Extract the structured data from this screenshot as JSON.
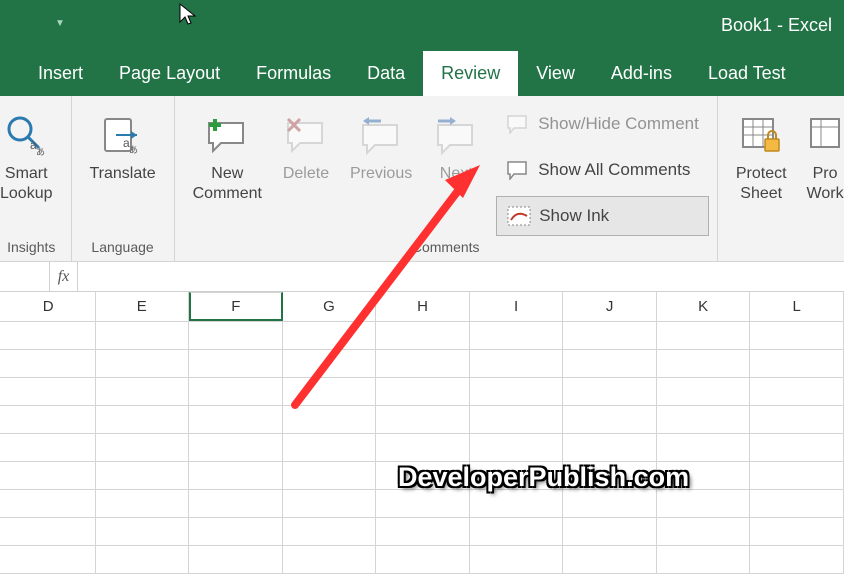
{
  "title": "Book1  -  Excel",
  "tabs": {
    "insert": "Insert",
    "page_layout": "Page Layout",
    "formulas": "Formulas",
    "data": "Data",
    "review": "Review",
    "view": "View",
    "addins": "Add-ins",
    "load_test": "Load Test"
  },
  "ribbon": {
    "insights_label": "Smart\nLookup",
    "insights_group": "Insights",
    "translate_label": "Translate",
    "language_group": "Language",
    "new_comment_label": "New\nComment",
    "delete_label": "Delete",
    "previous_label": "Previous",
    "next_label": "Next",
    "show_hide": "Show/Hide Comment",
    "show_all": "Show All Comments",
    "show_ink": "Show Ink",
    "comments_group": "Comments",
    "protect_sheet": "Protect\nSheet",
    "protect_workbook": "Pro\nWork"
  },
  "columns": {
    "c0": "D",
    "c1": "E",
    "c2": "F",
    "c3": "G",
    "c4": "H",
    "c5": "I",
    "c6": "J",
    "c7": "K",
    "c8": "L"
  },
  "fx": "fx",
  "watermark": "DeveloperPublish.com"
}
